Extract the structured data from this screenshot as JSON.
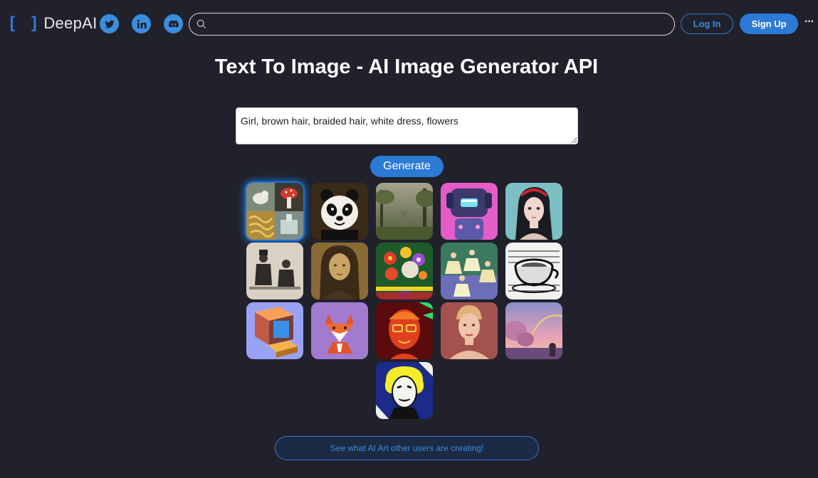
{
  "header": {
    "logo_brackets": "[ ]",
    "logo_text": "DeepAI",
    "social": [
      "twitter-icon",
      "linkedin-icon",
      "discord-icon"
    ],
    "search_value": "",
    "login_label": "Log In",
    "signup_label": "Sign Up",
    "more_label": "···"
  },
  "main": {
    "title": "Text To Image - AI Image Generator API",
    "prompt_value": "Girl, brown hair, braided hair, white dress, flowers",
    "generate_label": "Generate",
    "community_label": "See what AI Art other users are creating!"
  },
  "gallery": [
    {
      "name": "collage-wolf-mushroom-pasta",
      "selected": true
    },
    {
      "name": "panda"
    },
    {
      "name": "forest-landscape"
    },
    {
      "name": "pink-robot"
    },
    {
      "name": "anime-girl"
    },
    {
      "name": "vintage-photo-men"
    },
    {
      "name": "renaissance-portrait"
    },
    {
      "name": "flower-bouquet"
    },
    {
      "name": "ballet-dancers"
    },
    {
      "name": "teacup-sketch"
    },
    {
      "name": "isometric-computer"
    },
    {
      "name": "origami-fox"
    },
    {
      "name": "neon-face"
    },
    {
      "name": "woman-portrait"
    },
    {
      "name": "pastel-landscape"
    },
    {
      "name": "pop-art-marilyn"
    }
  ],
  "colors": {
    "background": "#20212b",
    "accent": "#2c7ad6",
    "social": "#3b8de0"
  }
}
